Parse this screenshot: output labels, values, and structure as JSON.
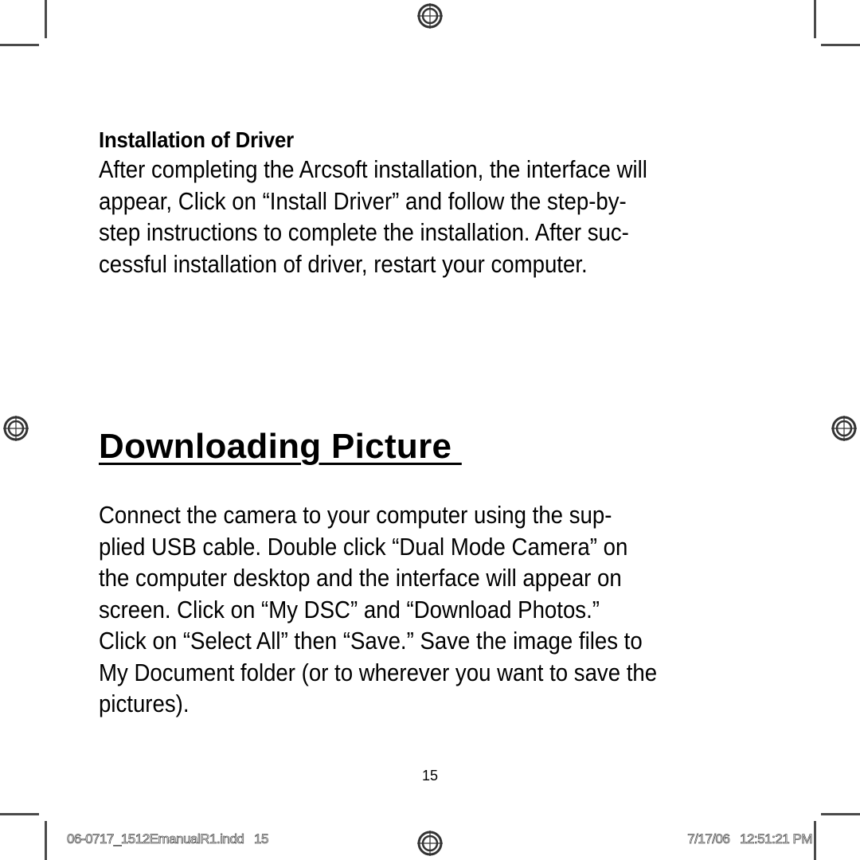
{
  "page": {
    "number": "15",
    "section1": {
      "heading": "Installation of Driver",
      "lines": [
        "After completing the Arcsoft installation, the interface will",
        "appear, Click on “Install Driver” and follow the step-by-",
        "step instructions to complete the installation.  After suc-",
        "cessful installation of driver, restart your computer."
      ]
    },
    "section2": {
      "heading": "Downloading Picture ",
      "lines": [
        "Connect the camera to your computer using the sup-",
        "plied USB cable. Double click “Dual Mode Camera” on",
        "the computer desktop and the interface will appear on",
        "screen.  Click on “My DSC”  and “Download Photos.”",
        "Click on “Select All” then “Save.”  Save the image files to",
        "My Document folder (or to wherever you want to save the",
        "pictures)."
      ]
    }
  },
  "print_slug": {
    "file_info": "06-0717_1512EmanualR1.indd   15",
    "timestamp": "7/17/06   12:51:21 PM"
  },
  "marks": {
    "crop_mark_color": "#4a4a4a",
    "registration_icon": "registration-target-icon"
  }
}
